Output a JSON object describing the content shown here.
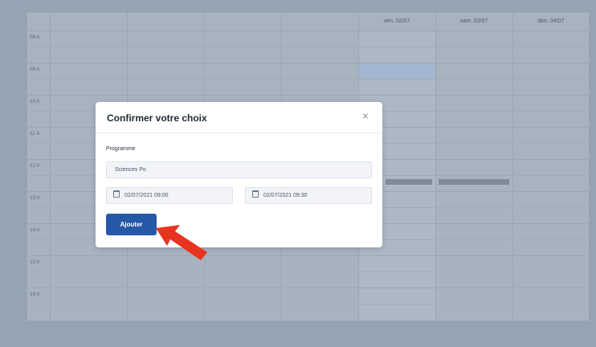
{
  "calendar": {
    "days": [
      "ven. 02/07",
      "sam. 03/07",
      "dim. 04/07"
    ],
    "hours": [
      "08 h",
      "09 h",
      "10 h",
      "11 h",
      "12 h",
      "13 h",
      "14 h",
      "15 h",
      "16 h"
    ]
  },
  "modal": {
    "title": "Confirmer votre choix",
    "close_label": "×",
    "program_label": "Programme",
    "program_value": "Sciences Po",
    "start_datetime": "02/07/2021 09:00",
    "end_datetime": "02/07/2021 09:30",
    "add_label": "Ajouter"
  },
  "colors": {
    "overlay": "#95a3b3",
    "primary": "#2559a7",
    "annotation_arrow": "#e8341f"
  },
  "icons": {
    "close": "close-icon",
    "calendar": "calendar-icon",
    "annotation": "red-arrow-icon"
  }
}
